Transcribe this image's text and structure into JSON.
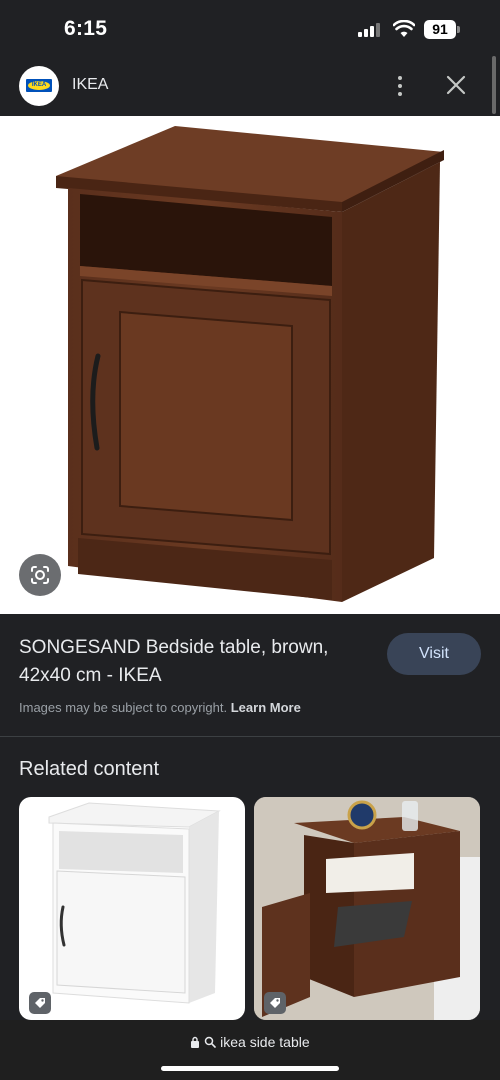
{
  "status_bar": {
    "time": "6:15",
    "battery": "91"
  },
  "header": {
    "site_name": "IKEA",
    "logo_text": "IKEA"
  },
  "result": {
    "title": "SONGESAND Bedside table, brown, 42x40 cm - IKEA",
    "visit_label": "Visit",
    "copyright_text": "Images may be subject to copyright.",
    "learn_more_label": "Learn More"
  },
  "related": {
    "heading": "Related content",
    "cards": [
      {
        "description": "white bedside table",
        "icon": "tag-icon"
      },
      {
        "description": "brown bedside table open door",
        "icon": "tag-icon"
      }
    ]
  },
  "address_bar": {
    "query": "ikea side table",
    "icons": [
      "lock-icon",
      "search-icon"
    ]
  },
  "colors": {
    "background": "#202124",
    "visit_button": "#394457",
    "table_brown": "#5a2f1c"
  }
}
